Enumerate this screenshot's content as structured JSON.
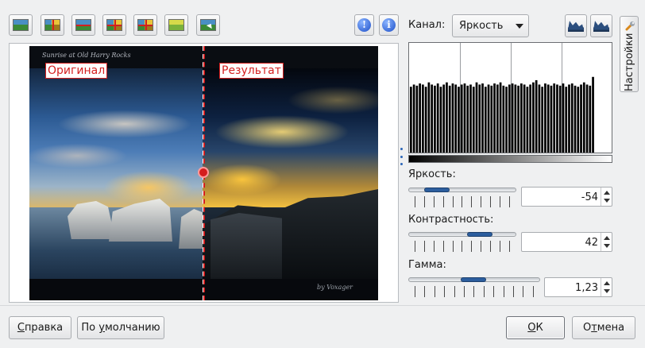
{
  "toolbar": {
    "buttons": [
      {
        "icon": "original-image-icon"
      },
      {
        "icon": "split-vertical-icon"
      },
      {
        "icon": "split-horizontal-icon"
      },
      {
        "icon": "duplicate-vertical-icon"
      },
      {
        "icon": "duplicate-horizontal-icon"
      },
      {
        "icon": "result-image-icon"
      },
      {
        "icon": "mouse-over-icon"
      }
    ],
    "info_buttons": [
      {
        "icon": "exclamation-info-icon",
        "label": "!"
      },
      {
        "icon": "info-icon",
        "label": "i"
      }
    ]
  },
  "preview": {
    "photo_title": "Sunrise at Old Harry Rocks",
    "photo_credit": "by Voxager",
    "label_original": "Оригинал",
    "label_result": "Результат"
  },
  "channel": {
    "label": "Канал:",
    "selected": "Яркость"
  },
  "histogram": {
    "bars": [
      0.6,
      0.62,
      0.61,
      0.63,
      0.62,
      0.6,
      0.64,
      0.62,
      0.61,
      0.63,
      0.6,
      0.62,
      0.64,
      0.61,
      0.63,
      0.62,
      0.6,
      0.62,
      0.63,
      0.61,
      0.62,
      0.6,
      0.64,
      0.62,
      0.63,
      0.6,
      0.62,
      0.61,
      0.63,
      0.62,
      0.64,
      0.61,
      0.6,
      0.62,
      0.63,
      0.62,
      0.61,
      0.63,
      0.62,
      0.6,
      0.62,
      0.64,
      0.66,
      0.62,
      0.6,
      0.63,
      0.62,
      0.61,
      0.63,
      0.62,
      0.61,
      0.63,
      0.6,
      0.62,
      0.63,
      0.61,
      0.6,
      0.62,
      0.64,
      0.62,
      0.61,
      0.69
    ]
  },
  "sliders": {
    "brightness": {
      "label": "Яркость:",
      "value": "-54",
      "level": 0.19
    },
    "contrast": {
      "label": "Контрастность:",
      "value": "42",
      "level": 0.71
    },
    "gamma": {
      "label": "Гамма:",
      "value": "1,23",
      "level": 0.49
    }
  },
  "side_tab": {
    "label": "Настройки"
  },
  "footer": {
    "help_first": "С",
    "help_rest": "правка",
    "defaults_first": "По ",
    "defaults_ul": "у",
    "defaults_rest": "молчанию",
    "ok_ul": "О",
    "ok_rest": "К",
    "cancel_first": "О",
    "cancel_ul": "т",
    "cancel_rest": "мена"
  },
  "colors": {
    "accent": "#2c5e9e",
    "label_red": "#d41e1e"
  }
}
